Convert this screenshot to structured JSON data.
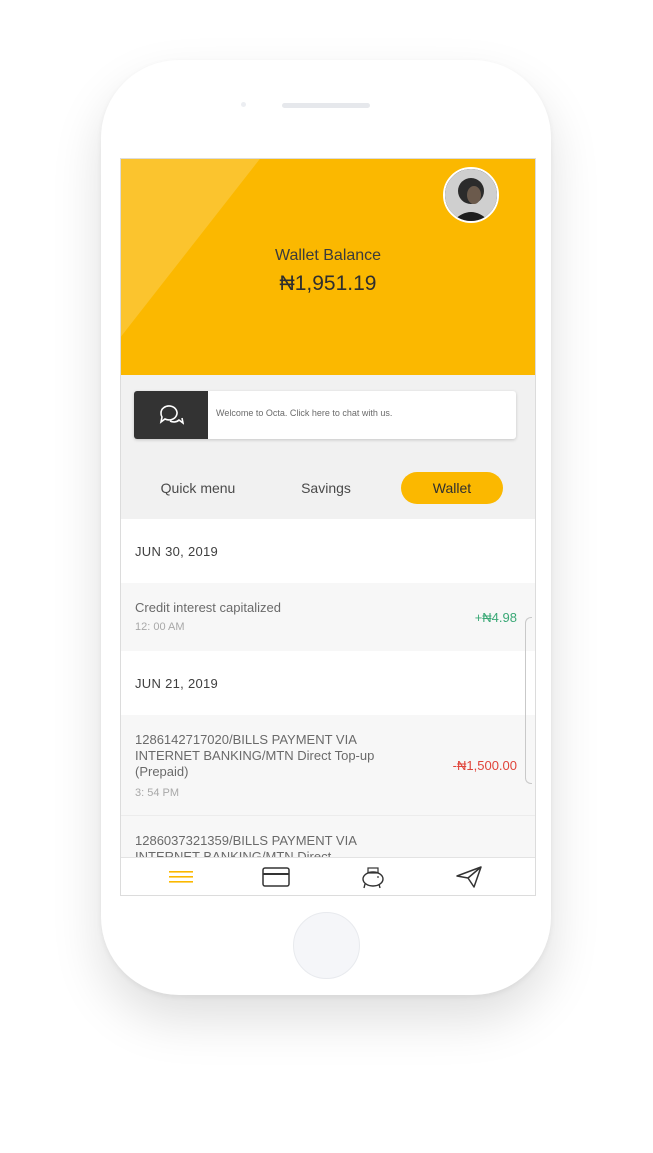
{
  "header": {
    "wallet_label": "Wallet Balance",
    "wallet_amount": "₦1,951.19",
    "accent_color": "#fbb800"
  },
  "chat_banner": {
    "icon": "chat-bubbles-icon",
    "text": "Welcome to Octa. Click here to chat with us."
  },
  "tabs": [
    {
      "label": "Quick menu",
      "active": false
    },
    {
      "label": "Savings",
      "active": false
    },
    {
      "label": "Wallet",
      "active": true
    }
  ],
  "transactions": [
    {
      "date": "JUN 30, 2019",
      "items": [
        {
          "description": "Credit interest capitalized",
          "time": "12: 00 AM",
          "amount": "+₦4.98",
          "type": "credit"
        }
      ]
    },
    {
      "date": "JUN 21, 2019",
      "items": [
        {
          "description": "1286142717020/BILLS PAYMENT VIA INTERNET BANKING/MTN Direct Top-up (Prepaid)",
          "time": "3: 54 PM",
          "amount": "-₦1,500.00",
          "type": "debit"
        },
        {
          "description": "1286037321359/BILLS PAYMENT VIA INTERNET BANKING/MTN Direct",
          "time": "",
          "amount": "",
          "type": "debit"
        }
      ]
    }
  ],
  "bottom_nav": [
    {
      "icon": "hamburger-menu-icon",
      "active": true
    },
    {
      "icon": "card-icon",
      "active": false
    },
    {
      "icon": "piggy-bank-icon",
      "active": false
    },
    {
      "icon": "paper-plane-icon",
      "active": false
    }
  ],
  "colors": {
    "credit": "#3aa876",
    "debit": "#e0443a",
    "dark": "#333333"
  }
}
